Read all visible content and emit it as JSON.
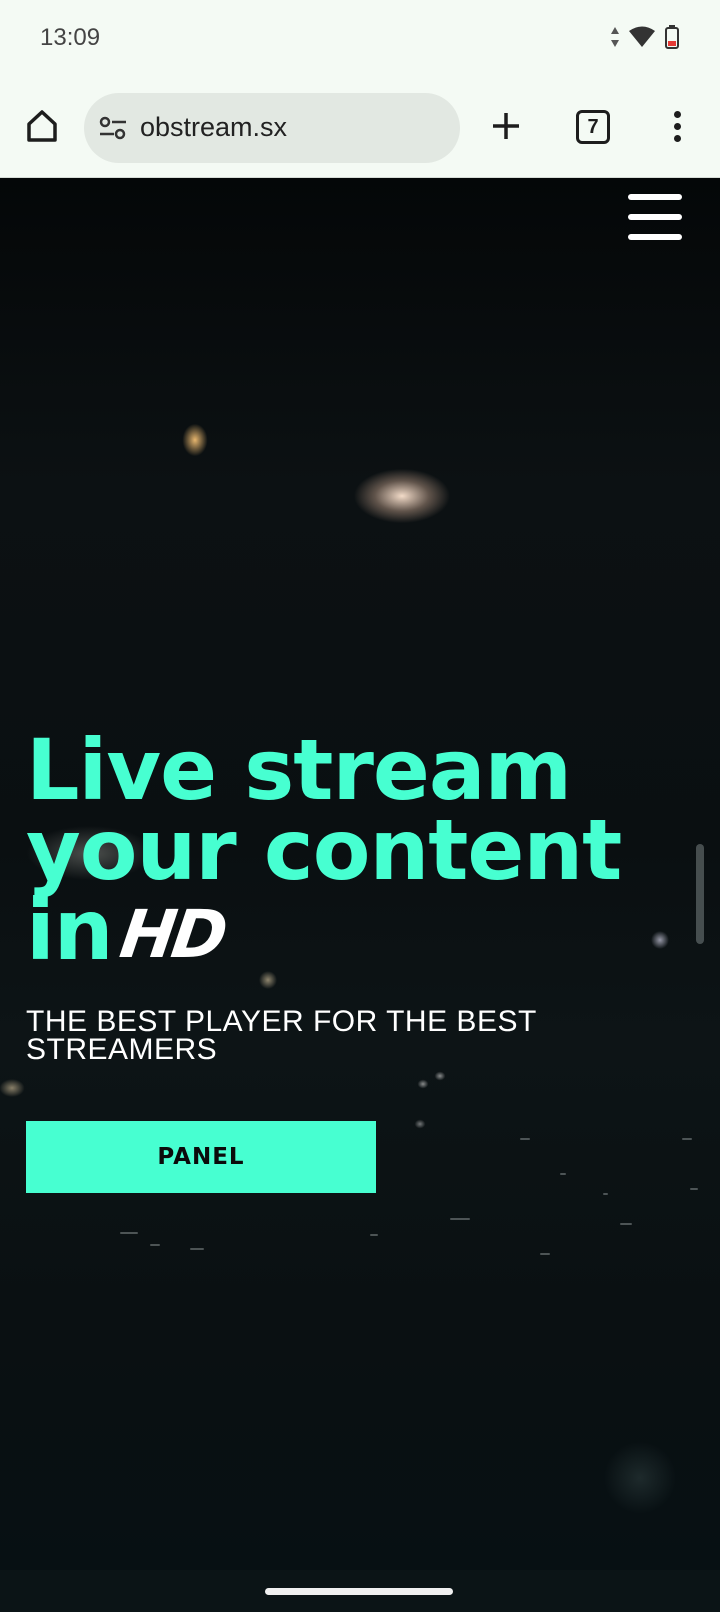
{
  "status_bar": {
    "time": "13:09",
    "icons": [
      "data-arrows-icon",
      "wifi-icon",
      "battery-low-icon"
    ],
    "battery_color": "#e53935"
  },
  "browser": {
    "url": "obstream.sx",
    "tab_count": "7",
    "icons": [
      "home-icon",
      "site-settings-icon",
      "new-tab-icon",
      "tab-switcher-icon",
      "more-menu-icon"
    ]
  },
  "page": {
    "headline_part1": "Live stream your content in",
    "headline_hd": "HD",
    "subtitle": "THE BEST PLAYER FOR THE BEST STREAMERS",
    "panel_button": "PANEL",
    "accent_color": "#47ffd1",
    "menu_icon": "hamburger-menu-icon"
  }
}
